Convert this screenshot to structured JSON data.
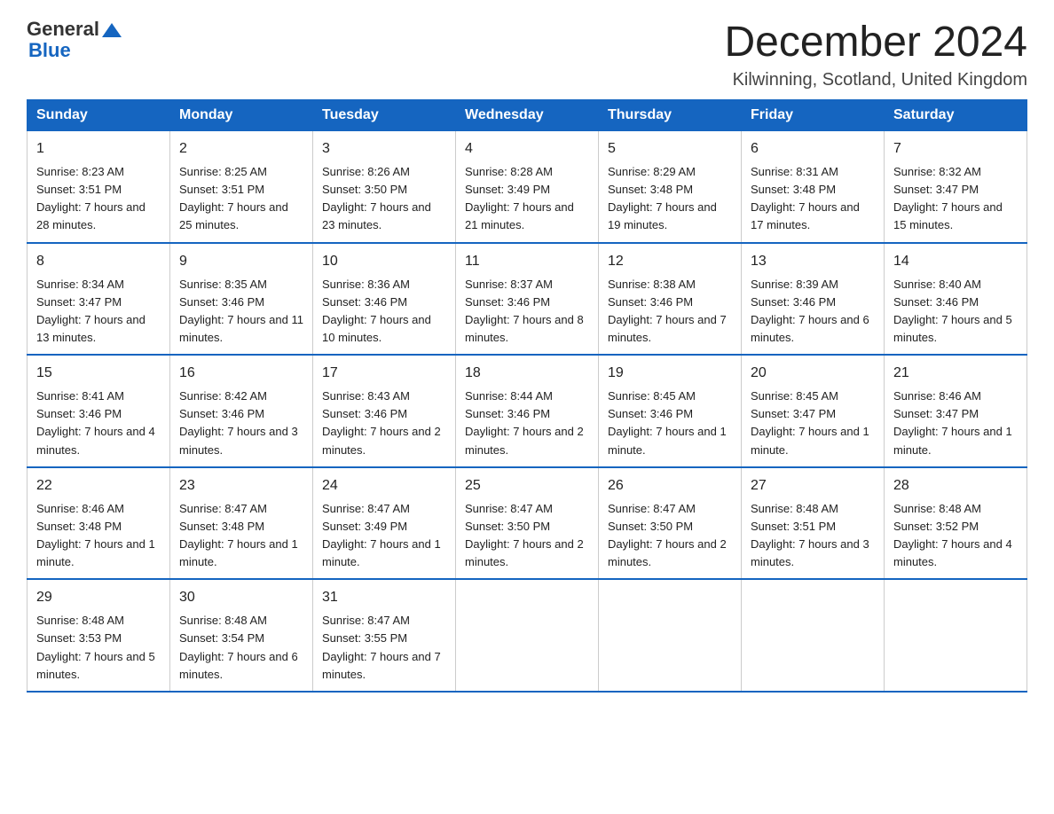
{
  "header": {
    "logo_general": "General",
    "logo_blue": "Blue",
    "month_title": "December 2024",
    "location": "Kilwinning, Scotland, United Kingdom"
  },
  "days_of_week": [
    "Sunday",
    "Monday",
    "Tuesday",
    "Wednesday",
    "Thursday",
    "Friday",
    "Saturday"
  ],
  "weeks": [
    [
      {
        "day": "1",
        "sunrise": "Sunrise: 8:23 AM",
        "sunset": "Sunset: 3:51 PM",
        "daylight": "Daylight: 7 hours and 28 minutes."
      },
      {
        "day": "2",
        "sunrise": "Sunrise: 8:25 AM",
        "sunset": "Sunset: 3:51 PM",
        "daylight": "Daylight: 7 hours and 25 minutes."
      },
      {
        "day": "3",
        "sunrise": "Sunrise: 8:26 AM",
        "sunset": "Sunset: 3:50 PM",
        "daylight": "Daylight: 7 hours and 23 minutes."
      },
      {
        "day": "4",
        "sunrise": "Sunrise: 8:28 AM",
        "sunset": "Sunset: 3:49 PM",
        "daylight": "Daylight: 7 hours and 21 minutes."
      },
      {
        "day": "5",
        "sunrise": "Sunrise: 8:29 AM",
        "sunset": "Sunset: 3:48 PM",
        "daylight": "Daylight: 7 hours and 19 minutes."
      },
      {
        "day": "6",
        "sunrise": "Sunrise: 8:31 AM",
        "sunset": "Sunset: 3:48 PM",
        "daylight": "Daylight: 7 hours and 17 minutes."
      },
      {
        "day": "7",
        "sunrise": "Sunrise: 8:32 AM",
        "sunset": "Sunset: 3:47 PM",
        "daylight": "Daylight: 7 hours and 15 minutes."
      }
    ],
    [
      {
        "day": "8",
        "sunrise": "Sunrise: 8:34 AM",
        "sunset": "Sunset: 3:47 PM",
        "daylight": "Daylight: 7 hours and 13 minutes."
      },
      {
        "day": "9",
        "sunrise": "Sunrise: 8:35 AM",
        "sunset": "Sunset: 3:46 PM",
        "daylight": "Daylight: 7 hours and 11 minutes."
      },
      {
        "day": "10",
        "sunrise": "Sunrise: 8:36 AM",
        "sunset": "Sunset: 3:46 PM",
        "daylight": "Daylight: 7 hours and 10 minutes."
      },
      {
        "day": "11",
        "sunrise": "Sunrise: 8:37 AM",
        "sunset": "Sunset: 3:46 PM",
        "daylight": "Daylight: 7 hours and 8 minutes."
      },
      {
        "day": "12",
        "sunrise": "Sunrise: 8:38 AM",
        "sunset": "Sunset: 3:46 PM",
        "daylight": "Daylight: 7 hours and 7 minutes."
      },
      {
        "day": "13",
        "sunrise": "Sunrise: 8:39 AM",
        "sunset": "Sunset: 3:46 PM",
        "daylight": "Daylight: 7 hours and 6 minutes."
      },
      {
        "day": "14",
        "sunrise": "Sunrise: 8:40 AM",
        "sunset": "Sunset: 3:46 PM",
        "daylight": "Daylight: 7 hours and 5 minutes."
      }
    ],
    [
      {
        "day": "15",
        "sunrise": "Sunrise: 8:41 AM",
        "sunset": "Sunset: 3:46 PM",
        "daylight": "Daylight: 7 hours and 4 minutes."
      },
      {
        "day": "16",
        "sunrise": "Sunrise: 8:42 AM",
        "sunset": "Sunset: 3:46 PM",
        "daylight": "Daylight: 7 hours and 3 minutes."
      },
      {
        "day": "17",
        "sunrise": "Sunrise: 8:43 AM",
        "sunset": "Sunset: 3:46 PM",
        "daylight": "Daylight: 7 hours and 2 minutes."
      },
      {
        "day": "18",
        "sunrise": "Sunrise: 8:44 AM",
        "sunset": "Sunset: 3:46 PM",
        "daylight": "Daylight: 7 hours and 2 minutes."
      },
      {
        "day": "19",
        "sunrise": "Sunrise: 8:45 AM",
        "sunset": "Sunset: 3:46 PM",
        "daylight": "Daylight: 7 hours and 1 minute."
      },
      {
        "day": "20",
        "sunrise": "Sunrise: 8:45 AM",
        "sunset": "Sunset: 3:47 PM",
        "daylight": "Daylight: 7 hours and 1 minute."
      },
      {
        "day": "21",
        "sunrise": "Sunrise: 8:46 AM",
        "sunset": "Sunset: 3:47 PM",
        "daylight": "Daylight: 7 hours and 1 minute."
      }
    ],
    [
      {
        "day": "22",
        "sunrise": "Sunrise: 8:46 AM",
        "sunset": "Sunset: 3:48 PM",
        "daylight": "Daylight: 7 hours and 1 minute."
      },
      {
        "day": "23",
        "sunrise": "Sunrise: 8:47 AM",
        "sunset": "Sunset: 3:48 PM",
        "daylight": "Daylight: 7 hours and 1 minute."
      },
      {
        "day": "24",
        "sunrise": "Sunrise: 8:47 AM",
        "sunset": "Sunset: 3:49 PM",
        "daylight": "Daylight: 7 hours and 1 minute."
      },
      {
        "day": "25",
        "sunrise": "Sunrise: 8:47 AM",
        "sunset": "Sunset: 3:50 PM",
        "daylight": "Daylight: 7 hours and 2 minutes."
      },
      {
        "day": "26",
        "sunrise": "Sunrise: 8:47 AM",
        "sunset": "Sunset: 3:50 PM",
        "daylight": "Daylight: 7 hours and 2 minutes."
      },
      {
        "day": "27",
        "sunrise": "Sunrise: 8:48 AM",
        "sunset": "Sunset: 3:51 PM",
        "daylight": "Daylight: 7 hours and 3 minutes."
      },
      {
        "day": "28",
        "sunrise": "Sunrise: 8:48 AM",
        "sunset": "Sunset: 3:52 PM",
        "daylight": "Daylight: 7 hours and 4 minutes."
      }
    ],
    [
      {
        "day": "29",
        "sunrise": "Sunrise: 8:48 AM",
        "sunset": "Sunset: 3:53 PM",
        "daylight": "Daylight: 7 hours and 5 minutes."
      },
      {
        "day": "30",
        "sunrise": "Sunrise: 8:48 AM",
        "sunset": "Sunset: 3:54 PM",
        "daylight": "Daylight: 7 hours and 6 minutes."
      },
      {
        "day": "31",
        "sunrise": "Sunrise: 8:47 AM",
        "sunset": "Sunset: 3:55 PM",
        "daylight": "Daylight: 7 hours and 7 minutes."
      },
      {
        "day": "",
        "sunrise": "",
        "sunset": "",
        "daylight": ""
      },
      {
        "day": "",
        "sunrise": "",
        "sunset": "",
        "daylight": ""
      },
      {
        "day": "",
        "sunrise": "",
        "sunset": "",
        "daylight": ""
      },
      {
        "day": "",
        "sunrise": "",
        "sunset": "",
        "daylight": ""
      }
    ]
  ]
}
